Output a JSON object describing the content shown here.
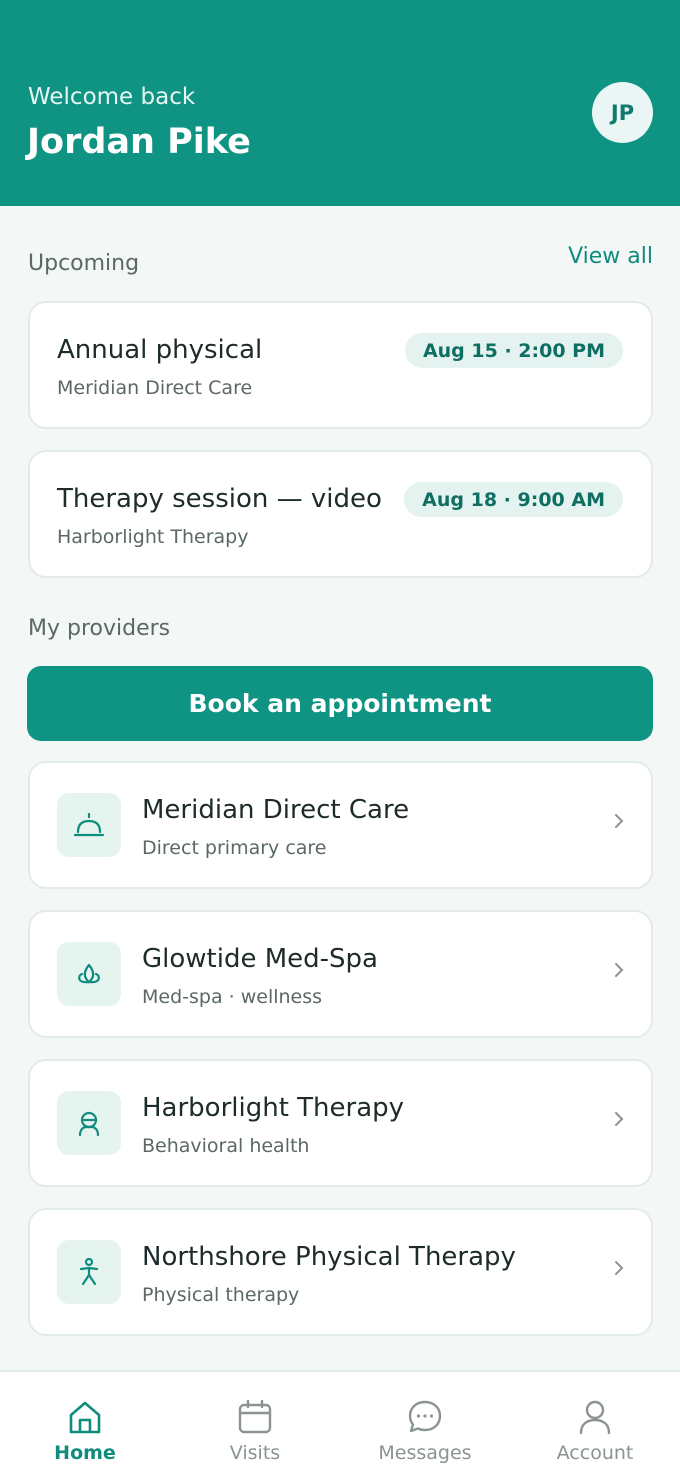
{
  "header": {
    "welcome": "Welcome back",
    "user_name": "Jordan Pike",
    "avatar_initials": "JP"
  },
  "upcoming": {
    "label": "Upcoming",
    "view_all": "View all",
    "items": [
      {
        "title": "Annual physical",
        "provider": "Meridian Direct Care",
        "when": "Aug 15 · 2:00 PM"
      },
      {
        "title": "Therapy session — video",
        "provider": "Harborlight Therapy",
        "when": "Aug 18 · 9:00 AM"
      }
    ]
  },
  "providers": {
    "label": "My providers",
    "book_button": "Book an appointment",
    "items": [
      {
        "name": "Meridian Direct Care",
        "type": "Direct primary care",
        "icon": "stethoscope-bell-icon"
      },
      {
        "name": "Glowtide Med-Spa",
        "type": "Med-spa · wellness",
        "icon": "lotus-icon"
      },
      {
        "name": "Harborlight Therapy",
        "type": "Behavioral health",
        "icon": "person-head-icon"
      },
      {
        "name": "Northshore Physical Therapy",
        "type": "Physical therapy",
        "icon": "stretching-person-icon"
      }
    ]
  },
  "nav": {
    "home": "Home",
    "visits": "Visits",
    "messages": "Messages",
    "account": "Account",
    "active": "home"
  },
  "colors": {
    "brand": "#0f9484",
    "accent_text": "#0f8c7d",
    "pill_bg": "#e4f3ef",
    "background": "#f3f7f6"
  }
}
